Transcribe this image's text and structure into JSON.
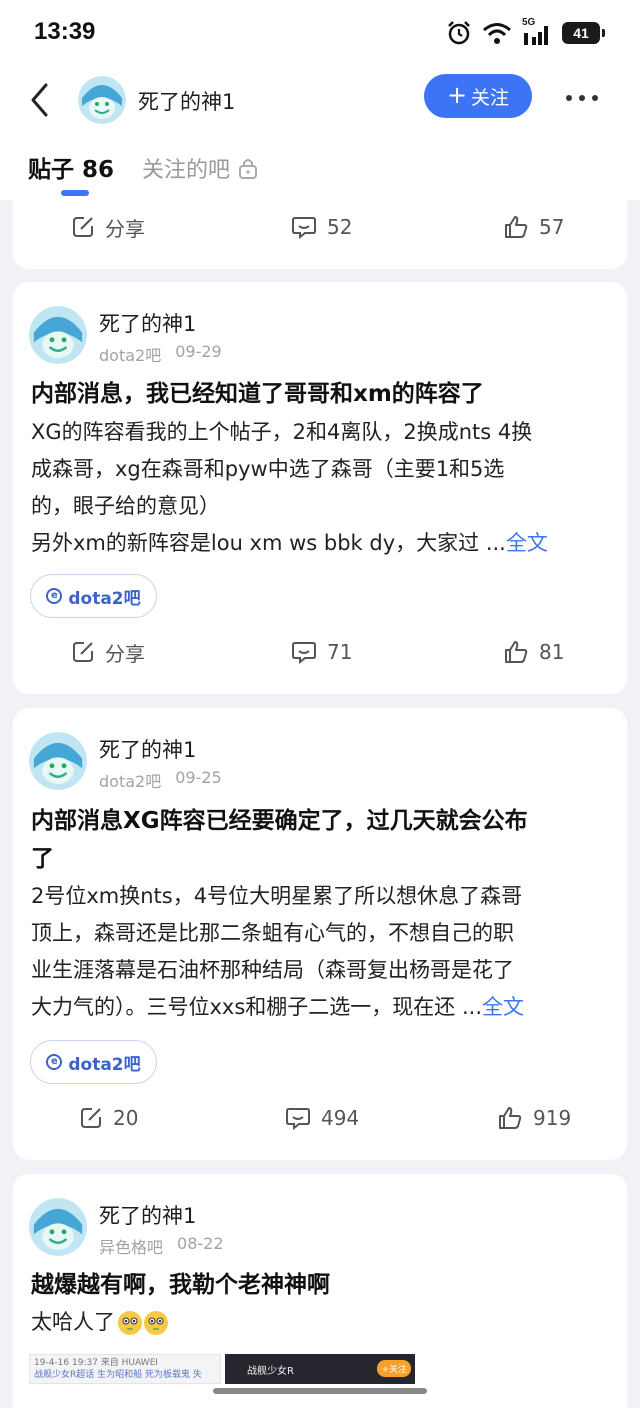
{
  "status_bar": {
    "time": "13:39",
    "network": "5G",
    "battery": "41"
  },
  "header": {
    "username": "死了的神1",
    "follow_label": "关注",
    "tab_posts_label": "贴子 86",
    "tab_follow_label": "关注的吧"
  },
  "colors": {
    "accent": "#3d74f5",
    "background": "#f1f2f5",
    "card": "#ffffff"
  },
  "posts": [
    {
      "share_label": "分享",
      "comments": "52",
      "likes": "57"
    },
    {
      "author": "死了的神1",
      "forum": "dota2吧",
      "date": "09-29",
      "title": "内部消息，我已经知道了哥哥和xm的阵容了",
      "body_lines": [
        "XG的阵容看我的上个帖子，2和4离队，2换成nts 4换",
        "成森哥，xg在森哥和pyw中选了森哥（主要1和5选",
        "的，眼子给的意见）",
        "另外xm的新阵容是lou xm ws bbk dy，大家过 ..."
      ],
      "full_text_label": "全文",
      "tag": "dota2吧",
      "share_label": "分享",
      "comments": "71",
      "likes": "81"
    },
    {
      "author": "死了的神1",
      "forum": "dota2吧",
      "date": "09-25",
      "title_lines": [
        "内部消息XG阵容已经要确定了，过几天就会公布",
        "了"
      ],
      "body_lines": [
        "2号位xm换nts，4号位大明星累了所以想休息了森哥",
        "顶上，森哥还是比那二条蛆有心气的，不想自己的职",
        "业生涯落幕是石油杯那种结局（森哥复出杨哥是花了",
        "大力气的）。三号位xxs和棚子二选一，现在还 ..."
      ],
      "full_text_label": "全文",
      "tag": "dota2吧",
      "shares": "20",
      "comments": "494",
      "likes": "919"
    },
    {
      "author": "死了的神1",
      "forum": "异色格吧",
      "date": "08-22",
      "title": "越爆越有啊，我勒个老神神啊",
      "body": "太哈人了",
      "thumb1_lines": [
        "19-4-16 19:37 来自 HUAWEI",
        "战舰少女R超话 生为昭和船 死为板载鬼 失"
      ],
      "thumb2_title": "战舰少女R",
      "thumb2_follow": "+关注"
    }
  ]
}
